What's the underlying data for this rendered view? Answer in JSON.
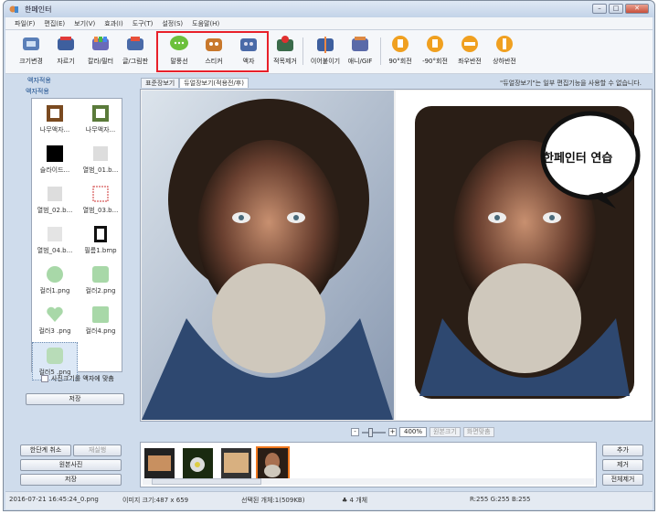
{
  "window": {
    "title": "한페인터"
  },
  "menu": [
    "파일(F)",
    "편집(E)",
    "보기(V)",
    "효과(I)",
    "도구(T)",
    "설정(S)",
    "도움말(H)"
  ],
  "toolbar": [
    {
      "label": "크기변경",
      "icon": "resize-icon"
    },
    {
      "label": "자르기",
      "icon": "crop-icon"
    },
    {
      "label": "칼라/필터",
      "icon": "color-filter-icon"
    },
    {
      "label": "글/그림판",
      "icon": "text-drawing-icon"
    },
    {
      "label": "말풍선",
      "icon": "speech-bubble-icon"
    },
    {
      "label": "스티커",
      "icon": "sticker-icon"
    },
    {
      "label": "액자",
      "icon": "frame-icon"
    },
    {
      "label": "적목제거",
      "icon": "red-eye-icon"
    },
    {
      "label": "이어붙이기",
      "icon": "merge-icon"
    },
    {
      "label": "애니/GIF",
      "icon": "gif-icon"
    },
    {
      "label": "90°회전",
      "icon": "rotate-right-icon"
    },
    {
      "label": "-90°회전",
      "icon": "rotate-left-icon"
    },
    {
      "label": "좌우반전",
      "icon": "flip-horizontal-icon"
    },
    {
      "label": "상하반전",
      "icon": "flip-vertical-icon"
    }
  ],
  "left_panel": {
    "title": "액자적용",
    "tab": "액자적용",
    "frames": [
      {
        "label": "나무액자...",
        "icon": "wood-frame-icon"
      },
      {
        "label": "나무액자...",
        "icon": "green-frame-icon"
      },
      {
        "label": "슬라이드...",
        "icon": "slide-frame-icon"
      },
      {
        "label": "열범_01.b...",
        "icon": "album-frame-icon"
      },
      {
        "label": "열범_02.b...",
        "icon": "album-frame-icon"
      },
      {
        "label": "열범_03.b...",
        "icon": "album-frame-icon"
      },
      {
        "label": "열범_04.b...",
        "icon": "album-frame-icon"
      },
      {
        "label": "필름1.bmp",
        "icon": "film-frame-icon"
      },
      {
        "label": "컬러1.png",
        "icon": "color-frame-icon"
      },
      {
        "label": "컬러2.png",
        "icon": "color-frame-icon"
      },
      {
        "label": "컬러3 .png",
        "icon": "color-frame-icon"
      },
      {
        "label": "컬러4.png",
        "icon": "color-frame-icon"
      },
      {
        "label": "컬러5 .png",
        "icon": "color-frame-icon",
        "selected": true
      }
    ],
    "fit_checkbox_label": "사진크기를 액자에 맞춤",
    "save_label": "저장"
  },
  "view_tabs": [
    {
      "label": "표준장보기",
      "active": false
    },
    {
      "label": "듀얼장보기(적용전/후)",
      "active": true
    }
  ],
  "notice": "\"듀얼장보기\"는 일부 편집기능을 사용할 수 없습니다.",
  "canvas": {
    "speech_bubble_text": "한페인터 연습"
  },
  "zoom": {
    "minus": "-",
    "plus": "+",
    "value": "400%",
    "actual_size": "원본크기",
    "fit_screen": "화면맞춤"
  },
  "bottom_left": {
    "undo": "한단계 취소",
    "redo": "재실행",
    "original": "원본사진",
    "save": "저장"
  },
  "bottom_right": {
    "add": "추가",
    "remove": "제거",
    "remove_all": "전체제거"
  },
  "status": {
    "file": "2016-07-21 16:45:24_0.png",
    "image_size": "이미지 크기:487 x 659",
    "selected": "선택된 개체:1(509KB)",
    "count": "4 개체",
    "rgb": "R:255 G:255 B:255"
  },
  "colors": {
    "highlight": "#e8202a",
    "selected_thumb": "#f0781e"
  }
}
